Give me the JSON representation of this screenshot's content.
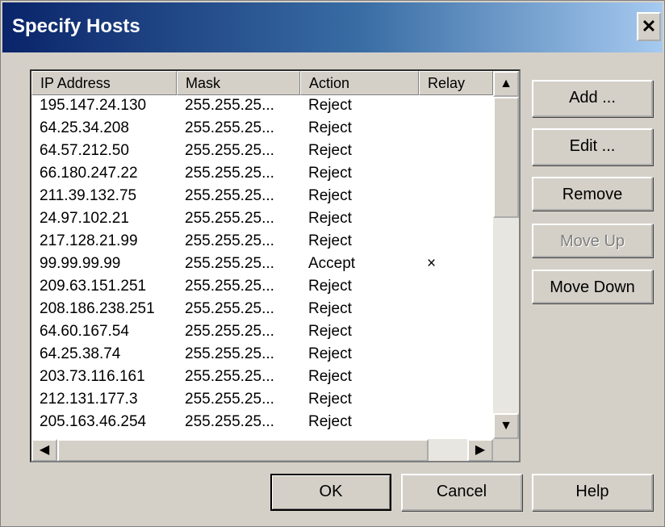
{
  "window": {
    "title": "Specify Hosts",
    "close_symbol": "✕"
  },
  "list": {
    "columns": [
      "IP Address",
      "Mask",
      "Action",
      "Relay"
    ],
    "rows": [
      {
        "ip": "195.147.24.130",
        "mask": "255.255.25...",
        "action": "Reject",
        "relay": ""
      },
      {
        "ip": "64.25.34.208",
        "mask": "255.255.25...",
        "action": "Reject",
        "relay": ""
      },
      {
        "ip": "64.57.212.50",
        "mask": "255.255.25...",
        "action": "Reject",
        "relay": ""
      },
      {
        "ip": "66.180.247.22",
        "mask": "255.255.25...",
        "action": "Reject",
        "relay": ""
      },
      {
        "ip": "211.39.132.75",
        "mask": "255.255.25...",
        "action": "Reject",
        "relay": ""
      },
      {
        "ip": "24.97.102.21",
        "mask": "255.255.25...",
        "action": "Reject",
        "relay": ""
      },
      {
        "ip": "217.128.21.99",
        "mask": "255.255.25...",
        "action": "Reject",
        "relay": ""
      },
      {
        "ip": "99.99.99.99",
        "mask": "255.255.25...",
        "action": "Accept",
        "relay": "×"
      },
      {
        "ip": "209.63.151.251",
        "mask": "255.255.25...",
        "action": "Reject",
        "relay": ""
      },
      {
        "ip": "208.186.238.251",
        "mask": "255.255.25...",
        "action": "Reject",
        "relay": ""
      },
      {
        "ip": "64.60.167.54",
        "mask": "255.255.25...",
        "action": "Reject",
        "relay": ""
      },
      {
        "ip": "64.25.38.74",
        "mask": "255.255.25...",
        "action": "Reject",
        "relay": ""
      },
      {
        "ip": "203.73.116.161",
        "mask": "255.255.25...",
        "action": "Reject",
        "relay": ""
      },
      {
        "ip": "212.131.177.3",
        "mask": "255.255.25...",
        "action": "Reject",
        "relay": ""
      },
      {
        "ip": "205.163.46.254",
        "mask": "255.255.25...",
        "action": "Reject",
        "relay": ""
      }
    ],
    "scroll_up": "▲",
    "scroll_down": "▼",
    "scroll_left": "◀",
    "scroll_right": "▶"
  },
  "buttons": {
    "add": "Add ...",
    "edit": "Edit ...",
    "remove": "Remove",
    "move_up": "Move Up",
    "move_down": "Move Down",
    "ok": "OK",
    "cancel": "Cancel",
    "help": "Help"
  }
}
